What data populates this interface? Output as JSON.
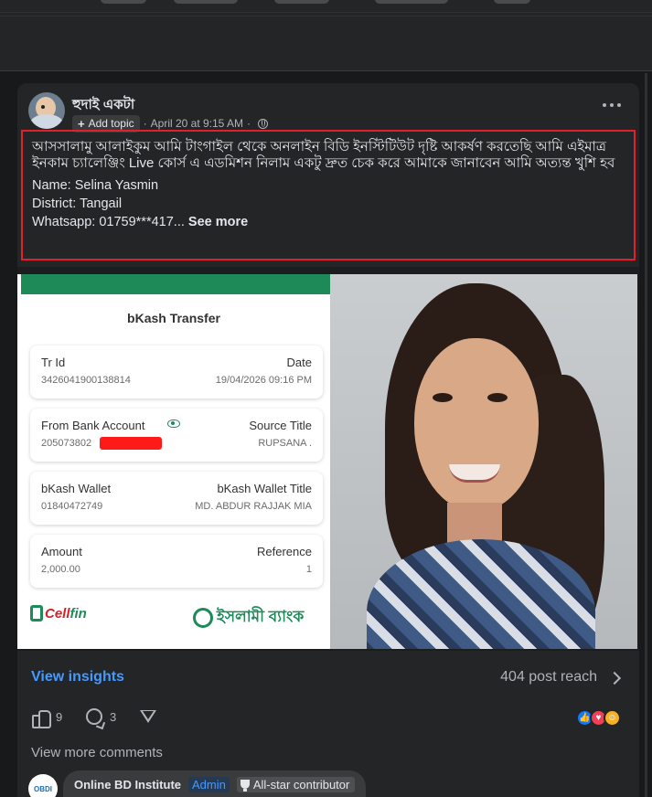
{
  "post": {
    "author": "হুদাই একটা",
    "add_topic": "Add topic",
    "date": "April 20 at 9:15 AM",
    "separator": "·",
    "text_bangla": "আসসালামু আলাইকুম আমি টাংগাইল থেকে অনলাইন বিডি ইনস্টিটিউট দৃষ্টি আকর্ষণ করতেছি আমি এইমাত্র ইনকাম চ্যালেঞ্জিং Live  কোর্স এ এডমিশন নিলাম একটু দ্রুত চেক করে আমাকে জানাবেন আমি অত্যন্ত খুশি হব",
    "name_line": "Name: Selina Yasmin",
    "district_line": "District: Tangail",
    "whatsapp_line": "Whatsapp: 01759***417...",
    "see_more": "See more"
  },
  "receipt": {
    "title": "bKash Transfer",
    "rows": [
      {
        "left_label": "Tr Id",
        "left_value": "3426041900138814",
        "right_label": "Date",
        "right_value": "19/04/2026 09:16 PM"
      },
      {
        "left_label": "From Bank Account",
        "left_value": "205073802",
        "right_label": "Source Title",
        "right_value": "RUPSANA ."
      },
      {
        "left_label": "bKash Wallet",
        "left_value": "01840472749",
        "right_label": "bKash Wallet Title",
        "right_value": "MD. ABDUR RAJJAK MIA"
      },
      {
        "left_label": "Amount",
        "left_value": "2,000.00",
        "right_label": "Reference",
        "right_value": "1"
      }
    ],
    "logo_left_a": "Cell",
    "logo_left_b": "fin",
    "logo_right": "ইসলামী ব্যাংক"
  },
  "insights": {
    "label": "View insights",
    "reach": "404 post reach"
  },
  "actions": {
    "likes": "9",
    "comments": "3"
  },
  "comments": {
    "view_more": "View more comments",
    "first": {
      "avatar_text": "OBDI",
      "name": "Online BD Institute",
      "role": "Admin",
      "badge": "All-star contributor"
    }
  },
  "colors": {
    "background": "#18191a",
    "card": "#242526",
    "accent": "#4599ff",
    "highlight_border": "#e0202a",
    "bkash_green": "#1d8a57"
  }
}
